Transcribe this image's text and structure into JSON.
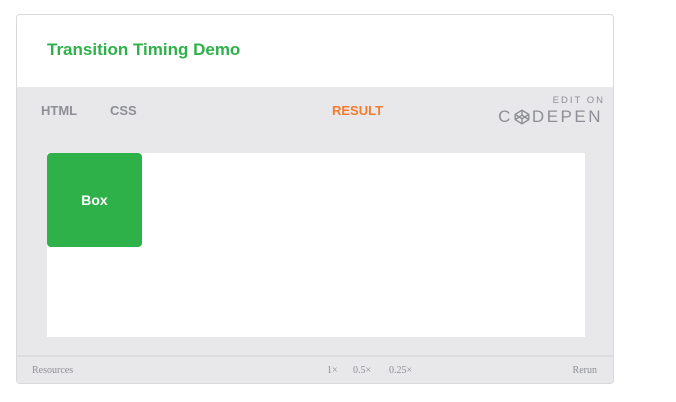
{
  "header": {
    "title": "Transition Timing Demo"
  },
  "tabs": {
    "html": "HTML",
    "css": "CSS",
    "result": "RESULT"
  },
  "codepen_badge": {
    "edit_on": "EDIT ON",
    "word_left": "C",
    "word_right": "DEPEN"
  },
  "result": {
    "box_label": "Box"
  },
  "footer": {
    "resources": "Resources",
    "speeds": [
      "1×",
      "0.5×",
      "0.25×"
    ],
    "rerun": "Rerun"
  },
  "colors": {
    "accent_green": "#2fb14a",
    "active_tab": "#f47a2c",
    "muted_text": "#8d8f95",
    "panel_bg": "#e8e8ea"
  },
  "icons": {
    "codepen_logo": "codepen-cube-icon"
  }
}
